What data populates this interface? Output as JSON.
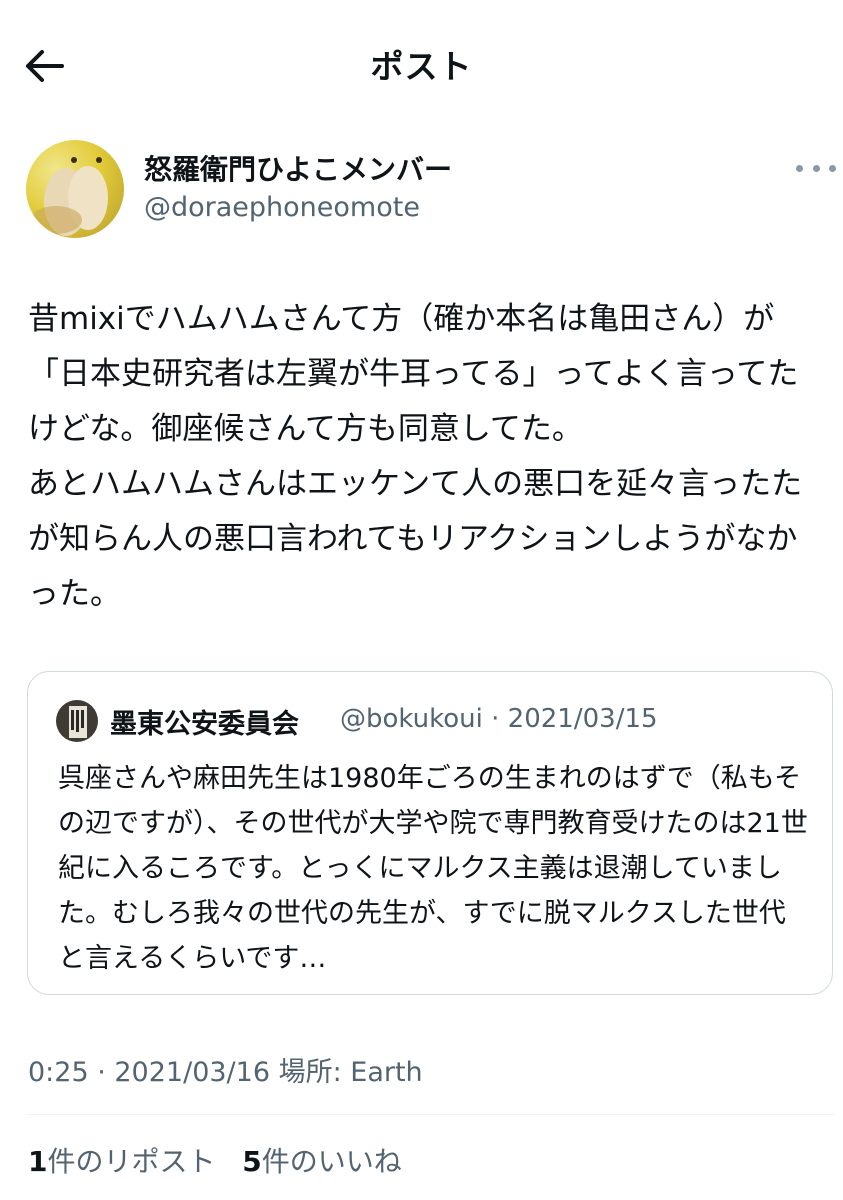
{
  "header": {
    "title": "ポスト",
    "back_icon": "arrow-left-icon"
  },
  "tweet": {
    "display_name": "怒羅衛門ひよこメンバー",
    "handle": "@doraephoneomote",
    "more_icon": "more-dots-icon",
    "body": "昔mixiでハムハムさんて方（確か本名は亀田さん）が「日本史研究者は左翼が牛耳ってる」ってよく言ってたけどな。御座候さんて方も同意してた。\nあとハムハムさんはエッケンて人の悪口を延々言ったたが知らん人の悪口言われてもリアクションしようがなかった。",
    "timestamp": "0:25 · 2021/03/16 場所: Earth"
  },
  "quote": {
    "display_name": "墨東公安委員会",
    "meta": "@bokukoui · 2021/03/15",
    "body": "呉座さんや麻田先生は1980年ごろの生まれのはずで（私もその辺ですが）、その世代が大学や院で専門教育受けたのは21世紀に入るころです。とっくにマルクス主義は退潮していました。むしろ我々の世代の先生が、すでに脱マルクスした世代と言えるくらいです…"
  },
  "stats": {
    "reposts_count": "1",
    "reposts_label": "件のリポスト",
    "likes_count": "5",
    "likes_label": "件のいいね"
  },
  "colors": {
    "text_primary": "#0f1419",
    "text_secondary": "#536471",
    "border": "#cfd9de",
    "divider": "#eff3f4"
  }
}
